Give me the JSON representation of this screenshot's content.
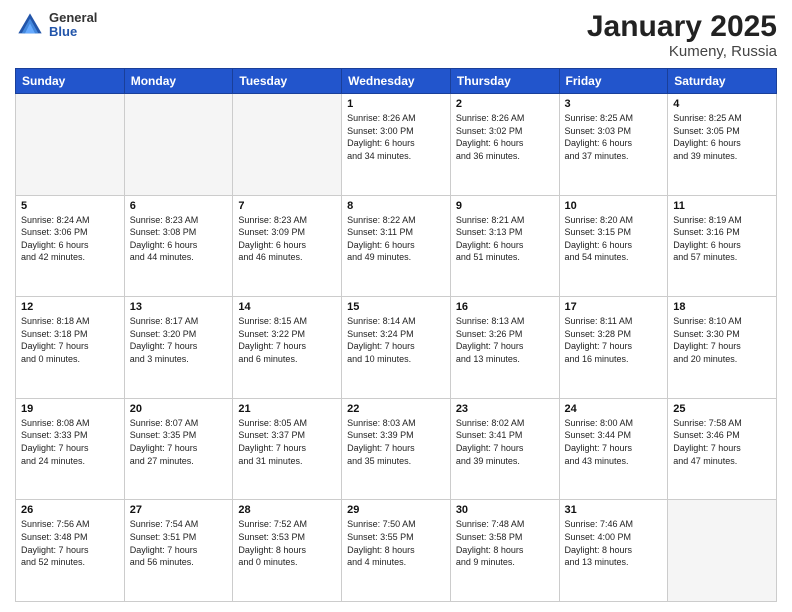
{
  "header": {
    "logo_general": "General",
    "logo_blue": "Blue",
    "title": "January 2025",
    "subtitle": "Kumeny, Russia"
  },
  "days_of_week": [
    "Sunday",
    "Monday",
    "Tuesday",
    "Wednesday",
    "Thursday",
    "Friday",
    "Saturday"
  ],
  "weeks": [
    [
      {
        "day": "",
        "info": ""
      },
      {
        "day": "",
        "info": ""
      },
      {
        "day": "",
        "info": ""
      },
      {
        "day": "1",
        "info": "Sunrise: 8:26 AM\nSunset: 3:00 PM\nDaylight: 6 hours\nand 34 minutes."
      },
      {
        "day": "2",
        "info": "Sunrise: 8:26 AM\nSunset: 3:02 PM\nDaylight: 6 hours\nand 36 minutes."
      },
      {
        "day": "3",
        "info": "Sunrise: 8:25 AM\nSunset: 3:03 PM\nDaylight: 6 hours\nand 37 minutes."
      },
      {
        "day": "4",
        "info": "Sunrise: 8:25 AM\nSunset: 3:05 PM\nDaylight: 6 hours\nand 39 minutes."
      }
    ],
    [
      {
        "day": "5",
        "info": "Sunrise: 8:24 AM\nSunset: 3:06 PM\nDaylight: 6 hours\nand 42 minutes."
      },
      {
        "day": "6",
        "info": "Sunrise: 8:23 AM\nSunset: 3:08 PM\nDaylight: 6 hours\nand 44 minutes."
      },
      {
        "day": "7",
        "info": "Sunrise: 8:23 AM\nSunset: 3:09 PM\nDaylight: 6 hours\nand 46 minutes."
      },
      {
        "day": "8",
        "info": "Sunrise: 8:22 AM\nSunset: 3:11 PM\nDaylight: 6 hours\nand 49 minutes."
      },
      {
        "day": "9",
        "info": "Sunrise: 8:21 AM\nSunset: 3:13 PM\nDaylight: 6 hours\nand 51 minutes."
      },
      {
        "day": "10",
        "info": "Sunrise: 8:20 AM\nSunset: 3:15 PM\nDaylight: 6 hours\nand 54 minutes."
      },
      {
        "day": "11",
        "info": "Sunrise: 8:19 AM\nSunset: 3:16 PM\nDaylight: 6 hours\nand 57 minutes."
      }
    ],
    [
      {
        "day": "12",
        "info": "Sunrise: 8:18 AM\nSunset: 3:18 PM\nDaylight: 7 hours\nand 0 minutes."
      },
      {
        "day": "13",
        "info": "Sunrise: 8:17 AM\nSunset: 3:20 PM\nDaylight: 7 hours\nand 3 minutes."
      },
      {
        "day": "14",
        "info": "Sunrise: 8:15 AM\nSunset: 3:22 PM\nDaylight: 7 hours\nand 6 minutes."
      },
      {
        "day": "15",
        "info": "Sunrise: 8:14 AM\nSunset: 3:24 PM\nDaylight: 7 hours\nand 10 minutes."
      },
      {
        "day": "16",
        "info": "Sunrise: 8:13 AM\nSunset: 3:26 PM\nDaylight: 7 hours\nand 13 minutes."
      },
      {
        "day": "17",
        "info": "Sunrise: 8:11 AM\nSunset: 3:28 PM\nDaylight: 7 hours\nand 16 minutes."
      },
      {
        "day": "18",
        "info": "Sunrise: 8:10 AM\nSunset: 3:30 PM\nDaylight: 7 hours\nand 20 minutes."
      }
    ],
    [
      {
        "day": "19",
        "info": "Sunrise: 8:08 AM\nSunset: 3:33 PM\nDaylight: 7 hours\nand 24 minutes."
      },
      {
        "day": "20",
        "info": "Sunrise: 8:07 AM\nSunset: 3:35 PM\nDaylight: 7 hours\nand 27 minutes."
      },
      {
        "day": "21",
        "info": "Sunrise: 8:05 AM\nSunset: 3:37 PM\nDaylight: 7 hours\nand 31 minutes."
      },
      {
        "day": "22",
        "info": "Sunrise: 8:03 AM\nSunset: 3:39 PM\nDaylight: 7 hours\nand 35 minutes."
      },
      {
        "day": "23",
        "info": "Sunrise: 8:02 AM\nSunset: 3:41 PM\nDaylight: 7 hours\nand 39 minutes."
      },
      {
        "day": "24",
        "info": "Sunrise: 8:00 AM\nSunset: 3:44 PM\nDaylight: 7 hours\nand 43 minutes."
      },
      {
        "day": "25",
        "info": "Sunrise: 7:58 AM\nSunset: 3:46 PM\nDaylight: 7 hours\nand 47 minutes."
      }
    ],
    [
      {
        "day": "26",
        "info": "Sunrise: 7:56 AM\nSunset: 3:48 PM\nDaylight: 7 hours\nand 52 minutes."
      },
      {
        "day": "27",
        "info": "Sunrise: 7:54 AM\nSunset: 3:51 PM\nDaylight: 7 hours\nand 56 minutes."
      },
      {
        "day": "28",
        "info": "Sunrise: 7:52 AM\nSunset: 3:53 PM\nDaylight: 8 hours\nand 0 minutes."
      },
      {
        "day": "29",
        "info": "Sunrise: 7:50 AM\nSunset: 3:55 PM\nDaylight: 8 hours\nand 4 minutes."
      },
      {
        "day": "30",
        "info": "Sunrise: 7:48 AM\nSunset: 3:58 PM\nDaylight: 8 hours\nand 9 minutes."
      },
      {
        "day": "31",
        "info": "Sunrise: 7:46 AM\nSunset: 4:00 PM\nDaylight: 8 hours\nand 13 minutes."
      },
      {
        "day": "",
        "info": ""
      }
    ]
  ]
}
